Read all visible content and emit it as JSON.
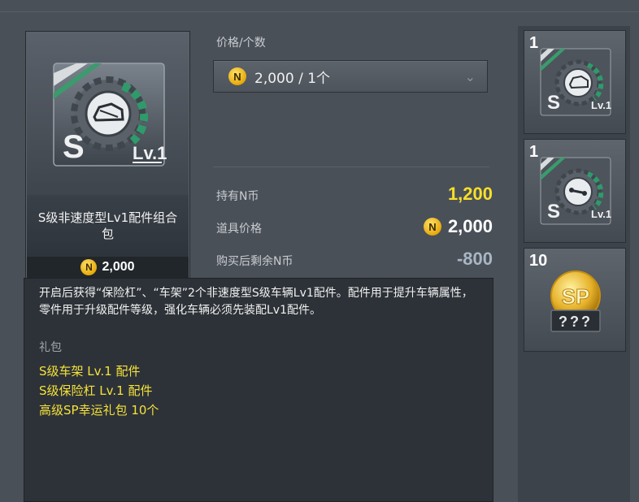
{
  "item": {
    "name": "S级非速度型Lv1配件组合包",
    "price": "2,000",
    "coin_symbol": "N",
    "icon": "gear-badge-icon",
    "grade_letter": "S",
    "level_badge": "Lv.1"
  },
  "purchase": {
    "price_count_label": "价格/个数",
    "selected_option": "2,000 / 1个",
    "owned_label": "持有N币",
    "owned_value": "1,200",
    "price_label": "道具价格",
    "price_value": "2,000",
    "remaining_label": "购买后剩余N币",
    "remaining_value": "-800"
  },
  "description": {
    "text": "开启后获得“保险杠”、“车架”2个非速度型S级车辆Lv1配件。配件用于提升车辆属性，零件用于升级配件等级，强化车辆必须先装配Lv1配件。",
    "contents_heading": "礼包",
    "contents": [
      "S级车架  Lv.1  配件",
      "S级保险杠  Lv.1  配件",
      "高级SP幸运礼包  10个"
    ]
  },
  "side_items": [
    {
      "count": "1",
      "icon": "chassis-part-icon",
      "grade_letter": "S",
      "level_badge": "Lv.1"
    },
    {
      "count": "1",
      "icon": "bumper-part-icon",
      "grade_letter": "S",
      "level_badge": "Lv.1"
    },
    {
      "count": "10",
      "icon": "sp-lucky-box-icon",
      "sp_label": "SP",
      "mystery_label": "???"
    }
  ],
  "colors": {
    "accent_yellow": "#f5e23a",
    "owned_value": "#f7df2a",
    "negative_value": "#a9b6c4",
    "gear_green": "#2f9a6a",
    "coin": "#f0b312"
  }
}
